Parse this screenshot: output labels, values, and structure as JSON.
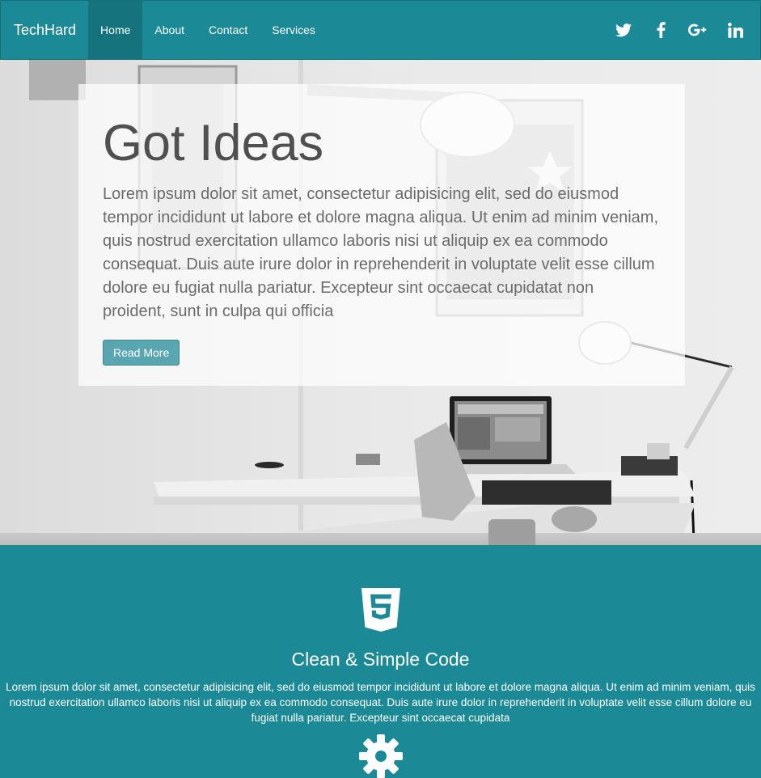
{
  "navbar": {
    "brand": "TechHard",
    "links": [
      {
        "label": "Home",
        "active": true
      },
      {
        "label": "About",
        "active": false
      },
      {
        "label": "Contact",
        "active": false
      },
      {
        "label": "Services",
        "active": false
      }
    ],
    "social_icons": [
      "twitter-icon",
      "facebook-icon",
      "google-plus-icon",
      "linkedin-icon"
    ],
    "color": "#1b8a96"
  },
  "hero": {
    "title": "Got Ideas",
    "text": "Lorem ipsum dolor sit amet, consectetur adipisicing elit, sed do eiusmod tempor incididunt ut labore et dolore magna aliqua. Ut enim ad minim veniam, quis nostrud exercitation ullamco laboris nisi ut aliquip ex ea commodo consequat. Duis aute irure dolor in reprehenderit in voluptate velit esse cillum dolore eu fugiat nulla pariatur. Excepteur sint occaecat cupidatat non proident, sunt in culpa qui officia",
    "button_label": "Read More",
    "background": "grayscale photo of a desk with laptop and desk lamps"
  },
  "features": {
    "items": [
      {
        "icon": "html5-icon",
        "title": "Clean & Simple Code",
        "text": "Lorem ipsum dolor sit amet, consectetur adipisicing elit, sed do eiusmod tempor incididunt ut labore et dolore magna aliqua. Ut enim ad minim veniam, quis nostrud exercitation ullamco laboris nisi ut aliquip ex ea commodo consequat. Duis aute irure dolor in reprehenderit in voluptate velit esse cillum dolore eu fugiat nulla pariatur. Excepteur sint occaecat cupidata"
      },
      {
        "icon": "gear-icon"
      }
    ]
  }
}
